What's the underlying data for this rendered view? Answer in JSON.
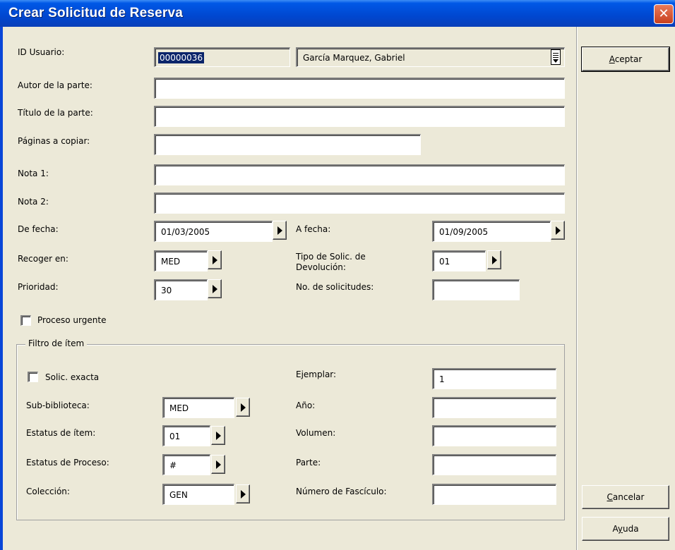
{
  "window": {
    "title": "Crear Solicitud de Reserva",
    "close_symbol": "✕"
  },
  "form": {
    "id_usuario": {
      "label": "ID Usuario:",
      "value": "00000036",
      "name_value": "García Marquez, Gabriel"
    },
    "autor": {
      "label": "Autor de la parte:",
      "value": ""
    },
    "titulo": {
      "label": "Título de la parte:",
      "value": ""
    },
    "paginas": {
      "label": "Páginas a copiar:",
      "value": ""
    },
    "nota1": {
      "label": "Nota 1:",
      "value": ""
    },
    "nota2": {
      "label": "Nota 2:",
      "value": ""
    },
    "de_fecha": {
      "label": "De fecha:",
      "value": "01/03/2005"
    },
    "a_fecha": {
      "label": "A fecha:",
      "value": "01/09/2005"
    },
    "recoger_en": {
      "label": "Recoger en:",
      "value": "MED"
    },
    "tipo_solic": {
      "label": "Tipo de Solic. de Devolución:",
      "value": "01"
    },
    "prioridad": {
      "label": "Prioridad:",
      "value": "30"
    },
    "no_solicitudes": {
      "label": "No. de solicitudes:",
      "value": ""
    },
    "proceso_urgente": {
      "label": "Proceso urgente",
      "checked": false
    }
  },
  "filtro": {
    "title": "Filtro de ítem",
    "solic_exacta": {
      "label": "Solic. exacta",
      "checked": false
    },
    "ejemplar": {
      "label": "Ejemplar:",
      "value": "1"
    },
    "sub_biblioteca": {
      "label": "Sub-biblioteca:",
      "value": "MED"
    },
    "anio": {
      "label": "Año:",
      "value": ""
    },
    "estatus_item": {
      "label": "Estatus de ítem:",
      "value": "01"
    },
    "volumen": {
      "label": "Volumen:",
      "value": ""
    },
    "estatus_proceso": {
      "label": "Estatus de Proceso:",
      "value": "#"
    },
    "parte": {
      "label": "Parte:",
      "value": ""
    },
    "coleccion": {
      "label": "Colección:",
      "value": "GEN"
    },
    "numero_fasciculo": {
      "label": "Número de Fascículo:",
      "value": ""
    }
  },
  "buttons": {
    "aceptar": {
      "first": "A",
      "rest": "ceptar"
    },
    "cancelar": {
      "first": "C",
      "rest": "ancelar"
    },
    "ayuda": {
      "pre": "A",
      "ul": "y",
      "post": "uda"
    }
  },
  "icons": {
    "close": "close-icon",
    "list": "list-icon",
    "arrow": "right-arrow-icon"
  }
}
